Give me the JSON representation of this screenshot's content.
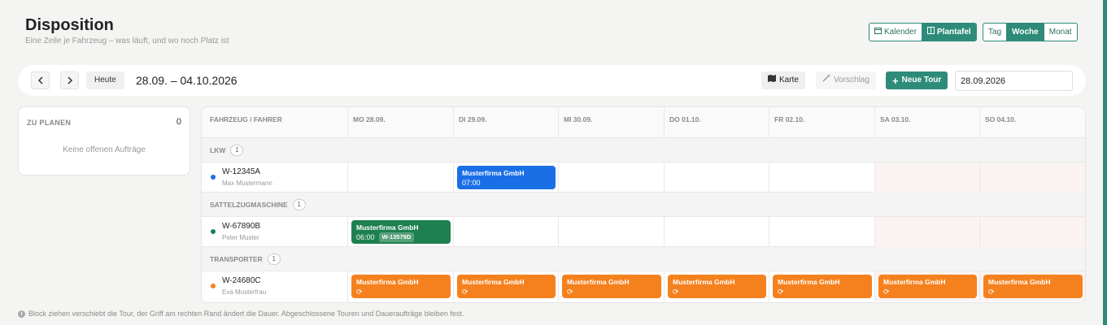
{
  "header": {
    "title": "Disposition",
    "subtitle": "Eine Zeile je Fahrzeug – was läuft, und wo noch Platz ist"
  },
  "view_switch": {
    "calendar": "Kalender",
    "plan": "Plantafel",
    "active": "Plantafel"
  },
  "range_switch": {
    "day": "Tag",
    "week": "Woche",
    "month": "Monat",
    "active": "Woche"
  },
  "toolbar": {
    "today": "Heute",
    "range": "28.09. – 04.10.2026",
    "map": "Karte",
    "suggest": "Vorschlag",
    "new_tour": "Neue Tour",
    "date_value": "28.09.2026"
  },
  "side": {
    "heading": "ZU PLANEN",
    "count": "0",
    "empty": "Keine offenen Aufträge"
  },
  "grid": {
    "vehicle_header": "FAHRZEUG / FAHRER",
    "days": [
      "MO 28.09.",
      "DI 29.09.",
      "MI 30.09.",
      "DO 01.10.",
      "FR 02.10.",
      "SA 03.10.",
      "SO 04.10."
    ],
    "groups": [
      {
        "name": "LKW",
        "count": "1",
        "vehicle": {
          "id": "W-12345A",
          "driver": "Max Mustermann",
          "color": "#1a6fe6"
        },
        "blocks": [
          {
            "company": "Musterfirma GmbH",
            "time": "07:00"
          }
        ]
      },
      {
        "name": "SATTELZUGMASCHINE",
        "count": "1",
        "vehicle": {
          "id": "W-67890B",
          "driver": "Peter Muster",
          "color": "#1e8050"
        },
        "blocks": [
          {
            "company": "Musterfirma GmbH",
            "time": "06:00",
            "tag": "W-13579D"
          }
        ]
      },
      {
        "name": "TRANSPORTER",
        "count": "1",
        "vehicle": {
          "id": "W-24680C",
          "driver": "Eva Musterfrau",
          "color": "#f5811e"
        },
        "blocks": [
          {
            "company": "Musterfirma GmbH",
            "icon": "recurring-icon"
          },
          {
            "company": "Musterfirma GmbH",
            "icon": "recurring-icon"
          },
          {
            "company": "Musterfirma GmbH",
            "icon": "recurring-icon"
          },
          {
            "company": "Musterfirma GmbH",
            "icon": "recurring-icon"
          },
          {
            "company": "Musterfirma GmbH",
            "icon": "recurring-icon"
          },
          {
            "company": "Musterfirma GmbH",
            "icon": "recurring-icon"
          },
          {
            "company": "Musterfirma GmbH",
            "icon": "recurring-icon"
          }
        ]
      }
    ]
  },
  "footer": "Block ziehen verschiebt die Tour, der Griff am rechten Rand ändert die Dauer. Abgeschlossene Touren und Daueraufträge bleiben fest."
}
